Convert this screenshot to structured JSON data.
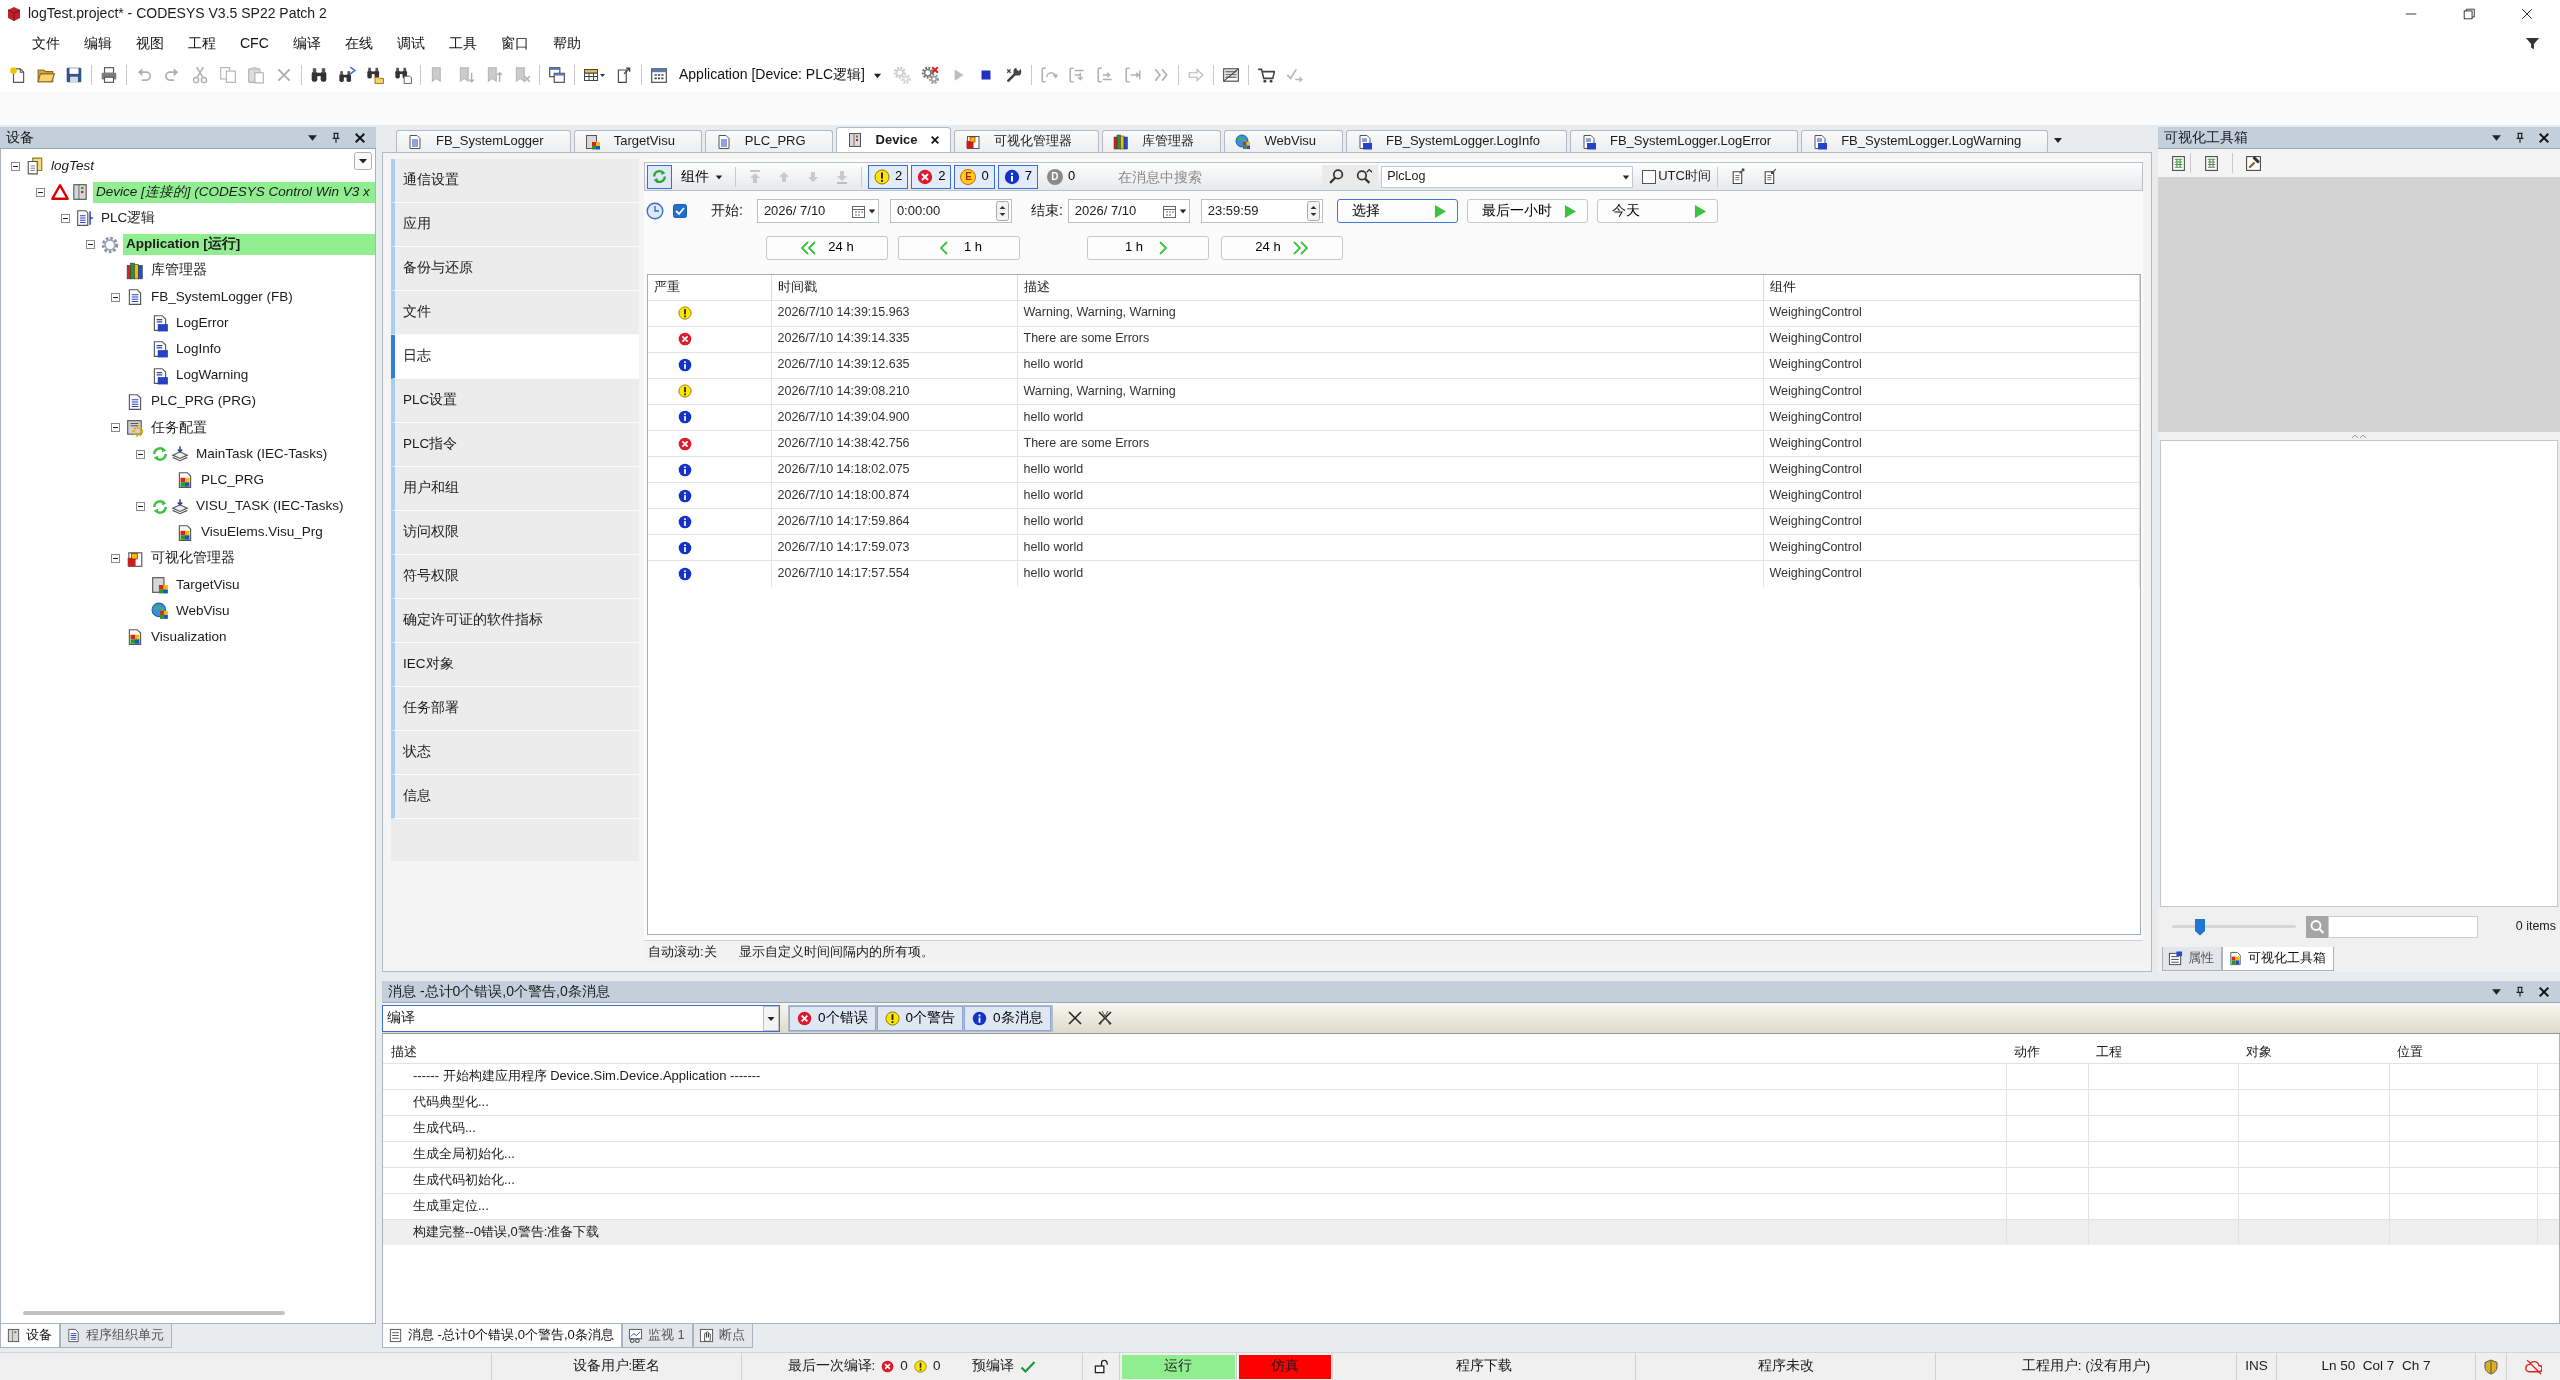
{
  "window": {
    "title": "logTest.project* - CODESYS V3.5 SP22 Patch 2"
  },
  "menu": [
    "文件",
    "编辑",
    "视图",
    "工程",
    "CFC",
    "编译",
    "在线",
    "调试",
    "工具",
    "窗口",
    "帮助"
  ],
  "toolbar": [
    {
      "items": [
        {
          "kind": "newfile",
          "disabled": false
        },
        {
          "kind": "open",
          "disabled": false
        },
        {
          "kind": "save",
          "disabled": false
        }
      ]
    },
    {
      "items": [
        {
          "kind": "print",
          "disabled": false
        }
      ]
    },
    {
      "items": [
        {
          "kind": "undo",
          "disabled": true
        },
        {
          "kind": "redo",
          "disabled": true
        },
        {
          "kind": "cut",
          "disabled": true
        },
        {
          "kind": "copy",
          "disabled": true
        },
        {
          "kind": "paste",
          "disabled": true
        },
        {
          "kind": "delete",
          "disabled": true
        }
      ]
    },
    {
      "items": [
        {
          "kind": "find",
          "disabled": false
        },
        {
          "kind": "replace",
          "disabled": false
        },
        {
          "kind": "findall",
          "disabled": false
        },
        {
          "kind": "replaceall",
          "disabled": false
        }
      ]
    },
    {
      "items": [
        {
          "kind": "bookmark",
          "disabled": true
        },
        {
          "kind": "bookmarknext",
          "disabled": true
        },
        {
          "kind": "bookmarkprev",
          "disabled": true
        },
        {
          "kind": "bookmarkclear",
          "disabled": true
        }
      ]
    },
    {
      "items": [
        {
          "kind": "windows",
          "disabled": false
        }
      ]
    },
    {
      "items": [
        {
          "kind": "gridmenu",
          "disabled": false
        },
        {
          "kind": "export",
          "disabled": false
        }
      ]
    },
    {
      "items": [
        {
          "kind": "calendar",
          "disabled": false
        },
        {
          "kind": "selector",
          "text": "Application [Device: PLC逻辑]"
        },
        {
          "kind": "login",
          "disabled": true
        },
        {
          "kind": "logout",
          "disabled": false
        },
        {
          "kind": "start",
          "disabled": true
        },
        {
          "kind": "stop",
          "disabled": false
        },
        {
          "kind": "reset",
          "disabled": false
        }
      ]
    },
    {
      "items": [
        {
          "kind": "stepover",
          "disabled": true
        },
        {
          "kind": "stepinto",
          "disabled": true
        },
        {
          "kind": "stepout",
          "disabled": true
        },
        {
          "kind": "runtocursor",
          "disabled": true
        },
        {
          "kind": "setnext",
          "disabled": true
        }
      ]
    },
    {
      "items": [
        {
          "kind": "showcurrent",
          "disabled": true
        }
      ]
    },
    {
      "items": [
        {
          "kind": "breakpoints",
          "disabled": false
        }
      ]
    },
    {
      "items": [
        {
          "kind": "writevalues",
          "disabled": false
        },
        {
          "kind": "forcevalues",
          "disabled": true
        }
      ]
    }
  ],
  "devices_panel": {
    "title": "设备",
    "tree": [
      {
        "label": "logTest",
        "kind": "project",
        "highlighted": false,
        "expanded": true,
        "children": [
          {
            "label": "Device [连接的] (CODESYS Control Win V3 x",
            "kind": "device",
            "highlighted": true,
            "expanded": true,
            "children": [
              {
                "label": "PLC逻辑",
                "kind": "logic",
                "highlighted": false,
                "expanded": true,
                "children": [
                  {
                    "label": "Application [运行]",
                    "kind": "application",
                    "highlighted": true,
                    "expanded": true,
                    "children": [
                      {
                        "label": "库管理器",
                        "kind": "library",
                        "highlighted": false
                      },
                      {
                        "label": "FB_SystemLogger (FB)",
                        "kind": "pou",
                        "highlighted": false,
                        "expanded": true,
                        "children": [
                          {
                            "label": "LogError",
                            "kind": "method",
                            "highlighted": false
                          },
                          {
                            "label": "LogInfo",
                            "kind": "method",
                            "highlighted": false
                          },
                          {
                            "label": "LogWarning",
                            "kind": "method",
                            "highlighted": false
                          }
                        ]
                      },
                      {
                        "label": "PLC_PRG (PRG)",
                        "kind": "pou",
                        "highlighted": false
                      },
                      {
                        "label": "任务配置",
                        "kind": "taskconfig",
                        "highlighted": false,
                        "expanded": true,
                        "children": [
                          {
                            "label": "MainTask (IEC-Tasks)",
                            "kind": "task",
                            "highlighted": false,
                            "expanded": true,
                            "children": [
                              {
                                "label": "PLC_PRG",
                                "kind": "call",
                                "highlighted": false
                              }
                            ]
                          },
                          {
                            "label": "VISU_TASK (IEC-Tasks)",
                            "kind": "task",
                            "highlighted": false,
                            "expanded": true,
                            "children": [
                              {
                                "label": "VisuElems.Visu_Prg",
                                "kind": "call",
                                "highlighted": false
                              }
                            ]
                          }
                        ]
                      },
                      {
                        "label": "可视化管理器",
                        "kind": "visumanager",
                        "highlighted": false,
                        "expanded": true,
                        "children": [
                          {
                            "label": "TargetVisu",
                            "kind": "targetvisu",
                            "highlighted": false
                          },
                          {
                            "label": "WebVisu",
                            "kind": "webvisu",
                            "highlighted": false
                          }
                        ]
                      },
                      {
                        "label": "Visualization",
                        "kind": "visualization",
                        "highlighted": false
                      }
                    ]
                  }
                ]
              }
            ]
          }
        ]
      }
    ],
    "tabs": [
      {
        "label": "设备",
        "kind": "devices",
        "selected": true
      },
      {
        "label": "程序组织单元",
        "kind": "pous",
        "selected": false
      }
    ]
  },
  "editor_tabs": [
    {
      "label": "FB_SystemLogger",
      "kind": "pou",
      "selected": false
    },
    {
      "label": "TargetVisu",
      "kind": "targetvisu",
      "selected": false
    },
    {
      "label": "PLC_PRG",
      "kind": "pou",
      "selected": false
    },
    {
      "label": "Device",
      "kind": "device",
      "selected": true
    },
    {
      "label": "可视化管理器",
      "kind": "visumanager",
      "selected": false
    },
    {
      "label": "库管理器",
      "kind": "library",
      "selected": false
    },
    {
      "label": "WebVisu",
      "kind": "webvisu",
      "selected": false
    },
    {
      "label": "FB_SystemLogger.LogInfo",
      "kind": "method",
      "selected": false
    },
    {
      "label": "FB_SystemLogger.LogError",
      "kind": "method",
      "selected": false
    },
    {
      "label": "FB_SystemLogger.LogWarning",
      "kind": "method",
      "selected": false
    }
  ],
  "device_editor": {
    "nav": [
      {
        "label": "通信设置",
        "selected": false
      },
      {
        "label": "应用",
        "selected": false
      },
      {
        "label": "备份与还原",
        "selected": false
      },
      {
        "label": "文件",
        "selected": false
      },
      {
        "label": "日志",
        "selected": true
      },
      {
        "label": "PLC设置",
        "selected": false
      },
      {
        "label": "PLC指令",
        "selected": false
      },
      {
        "label": "用户和组",
        "selected": false
      },
      {
        "label": "访问权限",
        "selected": false
      },
      {
        "label": "符号权限",
        "selected": false
      },
      {
        "label": "确定许可证的软件指标",
        "selected": false
      },
      {
        "label": "IEC对象",
        "selected": false
      },
      {
        "label": "任务部署",
        "selected": false
      },
      {
        "label": "状态",
        "selected": false
      },
      {
        "label": "信息",
        "selected": false
      }
    ],
    "log": {
      "refresh": {
        "on": true
      },
      "component": "组件",
      "move_buttons": [
        {
          "kind": "first",
          "disabled": true
        },
        {
          "kind": "up",
          "disabled": true
        },
        {
          "kind": "down",
          "disabled": true
        },
        {
          "kind": "last",
          "disabled": true
        }
      ],
      "filters": [
        {
          "kind": "warning",
          "count": "2",
          "selected": true
        },
        {
          "kind": "error",
          "count": "2",
          "selected": true
        },
        {
          "kind": "exception",
          "symbol": "E",
          "count": "0",
          "selected": true
        },
        {
          "kind": "info",
          "count": "7",
          "selected": true
        },
        {
          "kind": "debug",
          "symbol": "D",
          "count": "0",
          "selected": false
        }
      ],
      "search": {
        "placeholder": "在消息中搜索"
      },
      "logger": "PlcLog",
      "utc": {
        "label": "UTC时间",
        "checked": false
      },
      "range": {
        "enabled": true,
        "start": {
          "label": "开始:",
          "date": "2026/ 7/10",
          "time": "0:00:00"
        },
        "end": {
          "label": "结束:",
          "date": "2026/ 7/10",
          "time": "23:59:59"
        }
      },
      "actions": [
        {
          "label": "选择",
          "focused": true
        },
        {
          "label": "最后一小时",
          "focused": false
        },
        {
          "label": "今天",
          "focused": false
        }
      ],
      "steps": [
        {
          "label": "24 h",
          "kind": "rewind"
        },
        {
          "label": "1 h",
          "kind": "back"
        },
        {
          "label": "1 h",
          "kind": "forward"
        },
        {
          "label": "24 h",
          "kind": "fastforward"
        }
      ],
      "columns": [
        "严重",
        "时间戳",
        "描述",
        "组件"
      ],
      "rows": [
        {
          "kind": "warning",
          "timestamp": "2026/7/10 14:39:15.963",
          "description": "Warning, Warning, Warning",
          "component": "WeighingControl"
        },
        {
          "kind": "error",
          "timestamp": "2026/7/10 14:39:14.335",
          "description": "There are some Errors",
          "component": "WeighingControl"
        },
        {
          "kind": "info",
          "timestamp": "2026/7/10 14:39:12.635",
          "description": "hello world",
          "component": "WeighingControl"
        },
        {
          "kind": "warning",
          "timestamp": "2026/7/10 14:39:08.210",
          "description": "Warning, Warning, Warning",
          "component": "WeighingControl"
        },
        {
          "kind": "info",
          "timestamp": "2026/7/10 14:39:04.900",
          "description": "hello world",
          "component": "WeighingControl"
        },
        {
          "kind": "error",
          "timestamp": "2026/7/10 14:38:42.756",
          "description": "There are some Errors",
          "component": "WeighingControl"
        },
        {
          "kind": "info",
          "timestamp": "2026/7/10 14:18:02.075",
          "description": "hello world",
          "component": "WeighingControl"
        },
        {
          "kind": "info",
          "timestamp": "2026/7/10 14:18:00.874",
          "description": "hello world",
          "component": "WeighingControl"
        },
        {
          "kind": "info",
          "timestamp": "2026/7/10 14:17:59.864",
          "description": "hello world",
          "component": "WeighingControl"
        },
        {
          "kind": "info",
          "timestamp": "2026/7/10 14:17:59.073",
          "description": "hello world",
          "component": "WeighingControl"
        },
        {
          "kind": "info",
          "timestamp": "2026/7/10 14:17:57.554",
          "description": "hello world",
          "component": "WeighingControl"
        }
      ],
      "footer": {
        "autoscroll": "自动滚动:关",
        "hint": "显示自定义时间间隔内的所有项。"
      }
    }
  },
  "toolbox_panel": {
    "title": "可视化工具箱",
    "slider": {
      "level": 0.2
    },
    "count": "0 items",
    "tabs": [
      {
        "label": "属性",
        "kind": "properties",
        "selected": false
      },
      {
        "label": "可视化工具箱",
        "kind": "toolbox",
        "selected": true
      }
    ]
  },
  "messages_panel": {
    "title": "消息 -总计0个错误,0个警告,0条消息",
    "source": "编译",
    "filters": [
      {
        "kind": "error",
        "label": "0个错误",
        "selected": true
      },
      {
        "kind": "warning",
        "label": "0个警告",
        "selected": true
      },
      {
        "kind": "info",
        "label": "0条消息",
        "selected": true
      }
    ],
    "columns": [
      "描述",
      "动作",
      "工程",
      "对象",
      "位置"
    ],
    "rows": [
      {
        "text": "------ 开始构建应用程序 Device.Sim.Device.Application -------",
        "selected": false
      },
      {
        "text": "代码典型化...",
        "selected": false
      },
      {
        "text": "生成代码...",
        "selected": false
      },
      {
        "text": "生成全局初始化...",
        "selected": false
      },
      {
        "text": "生成代码初始化...",
        "selected": false
      },
      {
        "text": "生成重定位...",
        "selected": false
      },
      {
        "text": "构建完整--0错误,0警告:准备下载",
        "selected": true
      }
    ],
    "tabs": [
      {
        "label": "消息 -总计0个错误,0个警告,0条消息",
        "kind": "messages",
        "selected": true
      },
      {
        "label": "监视 1",
        "kind": "watch",
        "selected": false
      },
      {
        "label": "断点",
        "kind": "breakpoints",
        "selected": false
      }
    ]
  },
  "status_bar": {
    "device_user": "设备用户:匿名",
    "last_build": {
      "label": "最后一次编译:",
      "errors": "0",
      "warnings": "0"
    },
    "precompile": {
      "label": "预编译",
      "ok": true
    },
    "states": [
      {
        "label": "运行",
        "color": "#90ee90"
      },
      {
        "label": "仿真",
        "color": "#ff0000"
      }
    ],
    "download": "程序下载",
    "changes": "程序未改",
    "project_user": "工程用户: (没有用户)",
    "mode": "INS",
    "position": "Ln 50  Col 7  Ch 7"
  }
}
